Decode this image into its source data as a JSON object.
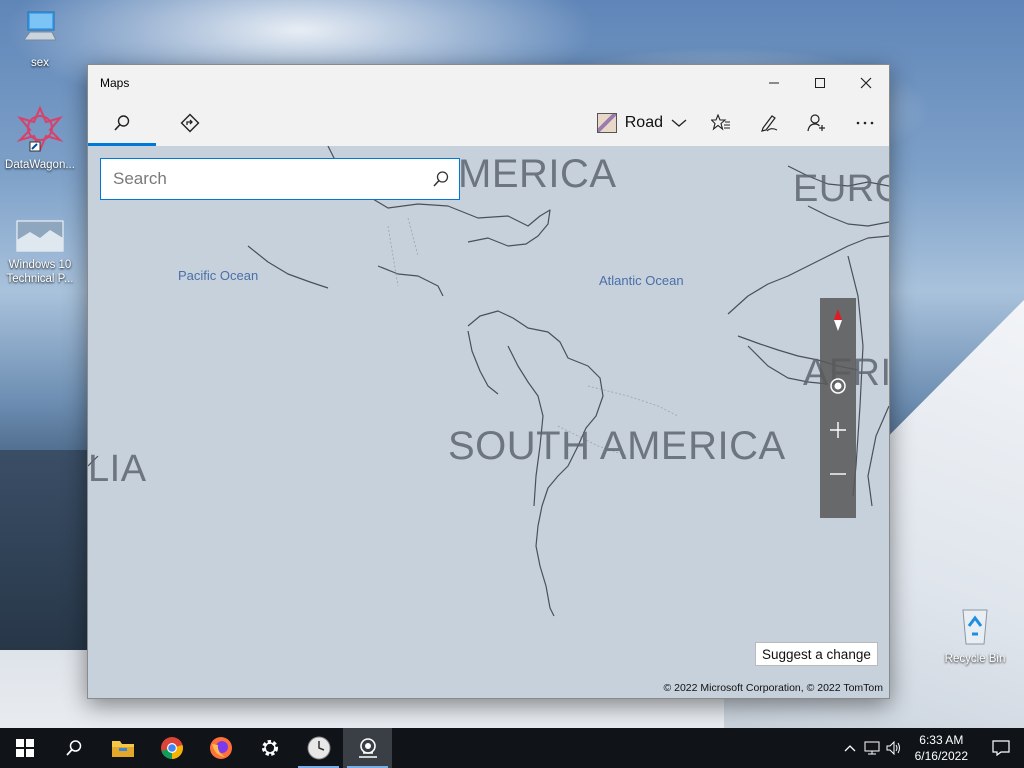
{
  "desktop": {
    "icons": [
      {
        "label": "sex",
        "icon": "computer-icon"
      },
      {
        "label": "DataWagon...",
        "icon": "datawagon-icon"
      },
      {
        "label": "Windows 10 Technical P...",
        "icon": "windows-image-icon"
      },
      {
        "label": "Recycle Bin",
        "icon": "recycle-bin-icon"
      }
    ]
  },
  "window": {
    "title": "Maps",
    "controls": {
      "minimize": "minimize-icon",
      "maximize": "maximize-icon",
      "close": "close-icon"
    }
  },
  "toolbar": {
    "tabs": [
      {
        "name": "search",
        "icon": "search-icon",
        "active": true
      },
      {
        "name": "directions",
        "icon": "directions-icon",
        "active": false
      }
    ],
    "map_style": "Road",
    "buttons": [
      "favorites-icon",
      "ink-icon",
      "account-icon",
      "more-icon"
    ]
  },
  "search": {
    "placeholder": "Search",
    "value": ""
  },
  "map": {
    "labels": {
      "north_america": "MERICA",
      "europe": "EURO",
      "africa": "AFRI",
      "south_america": "SOUTH AMERICA",
      "australia": "LIA",
      "pacific": "Pacific Ocean",
      "atlantic": "Atlantic Ocean"
    },
    "suggest": "Suggest a change",
    "copyright": "© 2022 Microsoft Corporation, © 2022 TomTom",
    "colors": {
      "water": "#c7d1dc",
      "ocean_label": "#4a6fa8"
    }
  },
  "zoom": {
    "compass": "compass-icon",
    "locate": "locate-icon",
    "in": "zoom-in-icon",
    "out": "zoom-out-icon"
  },
  "taskbar": {
    "apps": [
      "start-icon",
      "search-icon",
      "file-explorer-icon",
      "chrome-icon",
      "firefox-icon",
      "settings-icon",
      "clock-app-icon",
      "maps-icon"
    ],
    "time": "6:33 AM",
    "date": "6/16/2022"
  }
}
